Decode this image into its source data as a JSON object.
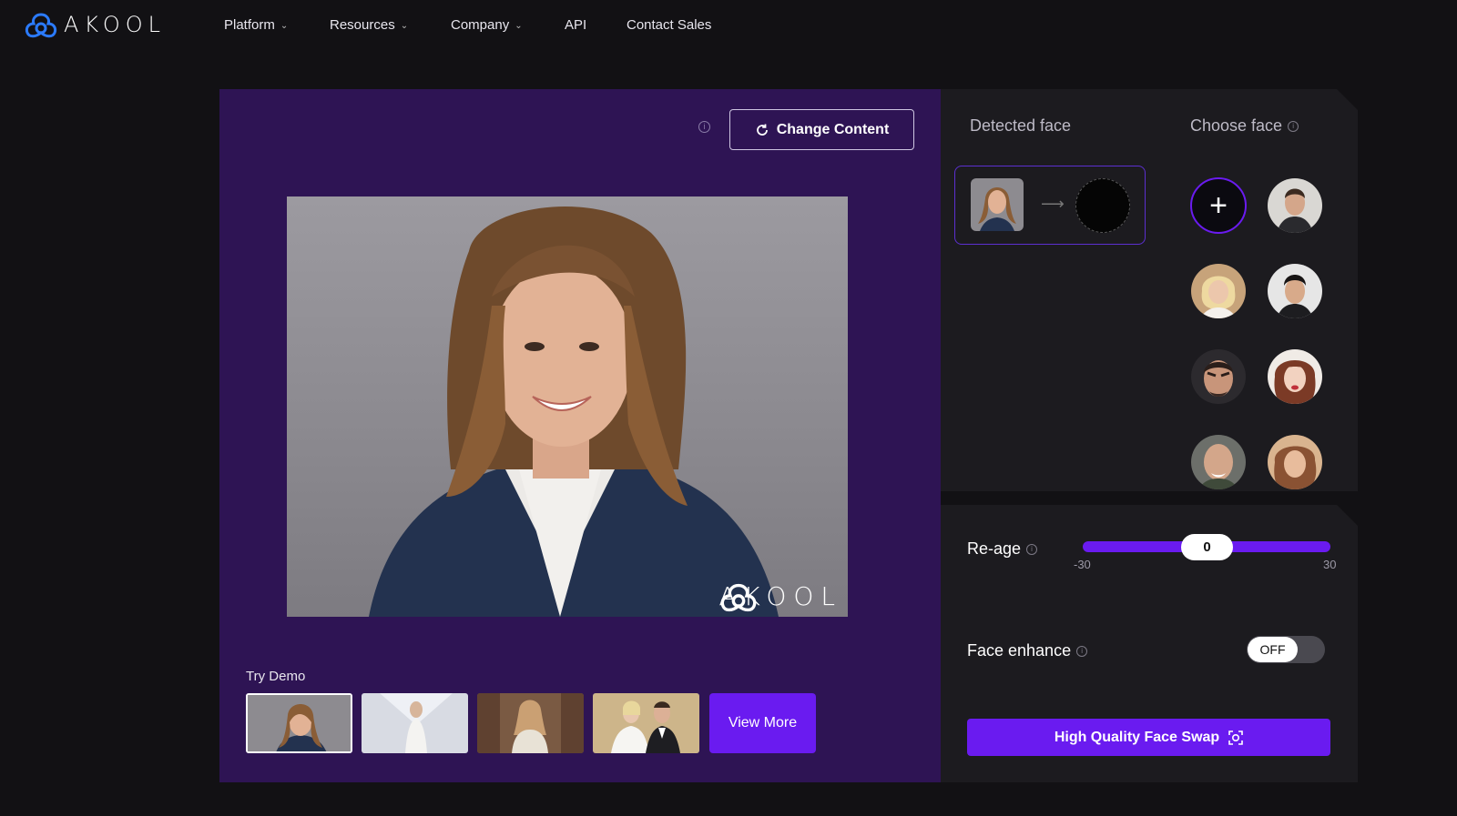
{
  "brand": {
    "name": "AKOOL",
    "accent": "#6a1bf0",
    "panel_bg": "#2e1454"
  },
  "nav": {
    "items": [
      {
        "label": "Platform",
        "has_dropdown": true
      },
      {
        "label": "Resources",
        "has_dropdown": true
      },
      {
        "label": "Company",
        "has_dropdown": true
      },
      {
        "label": "API",
        "has_dropdown": false
      },
      {
        "label": "Contact Sales",
        "has_dropdown": false
      }
    ]
  },
  "stage": {
    "change_content_label": "Change Content",
    "watermark_text": "AKOOL"
  },
  "demo": {
    "label": "Try Demo",
    "view_more_label": "View More",
    "selected_index": 0,
    "thumb_count": 4
  },
  "faces": {
    "detected_title": "Detected face",
    "choose_title": "Choose face",
    "choice_count": 8
  },
  "reage": {
    "label": "Re-age",
    "value": "0",
    "min": "-30",
    "max": "30"
  },
  "enhance": {
    "label": "Face enhance",
    "state": "OFF"
  },
  "swap_button_label": "High Quality Face Swap"
}
